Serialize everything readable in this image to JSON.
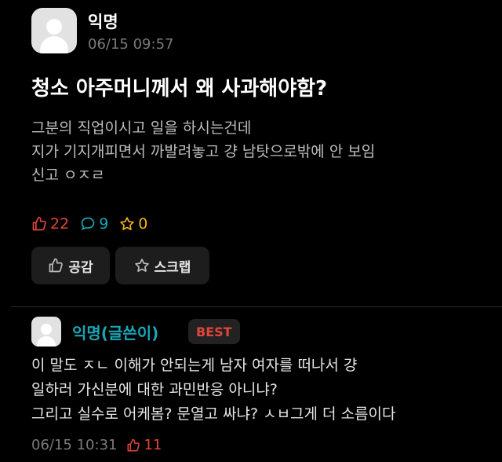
{
  "post": {
    "author": "익명",
    "time": "06/15 09:57",
    "title": "청소 아주머니께서 왜 사과해야함?",
    "body": "그분의 직업이시고 일을 하시는건데\n지가 기지개피면서 까발려놓고 걍 남탓으로밖에 안 보임\n신고 ㅇㅈㄹ",
    "likes": "22",
    "comments": "9",
    "scraps": "0"
  },
  "actions": {
    "like_label": "공감",
    "scrap_label": "스크랩"
  },
  "comment": {
    "author": "익명(글쓴이)",
    "badge": "BEST",
    "text": "이 말도 ㅈㄴ 이해가 안되는게 남자 여자를 떠나서 걍\n일하러 가신분에 대한 과민반응 아니냐?\n그리고 실수로 어케봄? 문열고 싸냐? ㅅㅂ그게 더 소름이다",
    "time": "06/15 10:31",
    "likes": "11"
  },
  "colors": {
    "background": "#000000",
    "accent_red": "#e2453a",
    "accent_teal": "#1aa6b7",
    "accent_gold": "#f0b21d"
  },
  "icons": [
    "thumbs-up-icon",
    "speech-bubble-icon",
    "star-icon"
  ]
}
